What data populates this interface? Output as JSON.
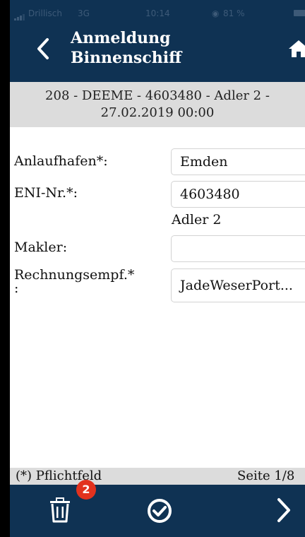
{
  "statusbar": {
    "carrier": "Drillisch",
    "network": "3G",
    "time": "10:14",
    "battery": "81 %"
  },
  "header": {
    "title_line1": "Anmeldung",
    "title_line2": "Binnenschiff",
    "back_icon": "chevron-left-icon",
    "home_icon": "home-icon"
  },
  "banner": {
    "line1": "208 - DEEME - 4603480 - Adler 2 -",
    "line2": "27.02.2019 00:00"
  },
  "form": {
    "anlaufhafen_label": "Anlaufhafen*:",
    "anlaufhafen_value": "Emden",
    "eni_label": "ENI-Nr.*:",
    "eni_value": "4603480",
    "ship_name": "Adler 2",
    "makler_label": "Makler:",
    "makler_value": "",
    "rechnung_label_line1": "Rechnungsempf.*",
    "rechnung_label_line2": ":",
    "rechnung_value": "JadeWeserPort..."
  },
  "footer": {
    "required_note": "(*) Pflichtfeld",
    "page_indicator": "Seite 1/8"
  },
  "toolbar": {
    "delete_badge": "2",
    "delete_icon": "trash-icon",
    "confirm_icon": "check-circle-icon",
    "next_icon": "chevron-right-icon"
  },
  "colors": {
    "header_bg": "#0f3253",
    "banner_bg": "#dcdcdc",
    "badge": "#e2321e"
  }
}
